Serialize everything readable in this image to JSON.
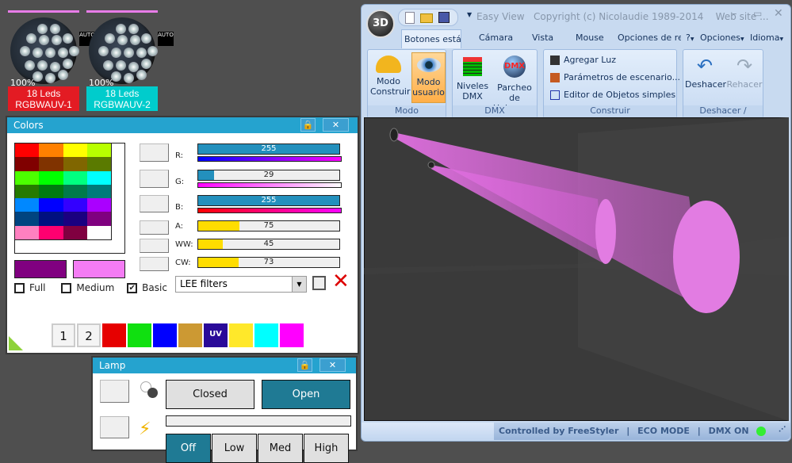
{
  "fixtures": [
    {
      "intensity": "100%",
      "name_line1": "18 Leds",
      "name_line2": "RGBWAUV-1",
      "auto_label": "AUTO",
      "color": "#e31b23"
    },
    {
      "intensity": "100%",
      "name_line1": "18 Leds",
      "name_line2": "RGBWAUV-2",
      "auto_label": "AUTO",
      "color": "#00cccc"
    }
  ],
  "colors_window": {
    "title": "Colors",
    "palette": [
      "#ff0000",
      "#ff8000",
      "#ffff00",
      "#b8ff00",
      "#800000",
      "#803300",
      "#806600",
      "#5a7a00",
      "#4cff00",
      "#00ff00",
      "#00ff80",
      "#00ffff",
      "#267a00",
      "#007a10",
      "#007a4a",
      "#007a7a",
      "#0088ff",
      "#0000ff",
      "#3300ff",
      "#aa00ff",
      "#004480",
      "#001080",
      "#1a0080",
      "#800080",
      "#ff80c0",
      "#ff0070",
      "#800040",
      "#ffffff"
    ],
    "selected_color_1": "#800080",
    "selected_color_2": "#f47cf4",
    "channels": [
      {
        "label": "R:",
        "value": 255,
        "max": 255,
        "fill": "#2390bd",
        "gradient": "linear-gradient(90deg,#0000ff,#ff00ff)"
      },
      {
        "label": "G:",
        "value": 29,
        "max": 255,
        "fill": "#2390bd",
        "gradient": "linear-gradient(90deg,#ff00ff,#fff)"
      },
      {
        "label": "B:",
        "value": 255,
        "max": 255,
        "fill": "#2390bd",
        "gradient": "linear-gradient(90deg,#ff0000,#ff00ff)"
      },
      {
        "label": "A:",
        "value": 75,
        "max": 255,
        "fill": "#ffdd00"
      },
      {
        "label": "WW:",
        "value": 45,
        "max": 255,
        "fill": "#ffdd00"
      },
      {
        "label": "CW:",
        "value": 73,
        "max": 255,
        "fill": "#ffdd00"
      }
    ],
    "filters": {
      "full": "Full",
      "medium": "Medium",
      "basic": "Basic",
      "full_checked": false,
      "medium_checked": false,
      "basic_checked": true
    },
    "filter_select": "LEE filters",
    "swatches": [
      {
        "label": "1",
        "color": "#f4f4f4"
      },
      {
        "label": "2",
        "color": "#f4f4f4"
      },
      {
        "label": "",
        "color": "#e60000"
      },
      {
        "label": "",
        "color": "#10e010"
      },
      {
        "label": "",
        "color": "#0000ff"
      },
      {
        "label": "",
        "color": "#cc9933"
      },
      {
        "label": "UV",
        "color": "#2a0a99"
      },
      {
        "label": "",
        "color": "#ffe82a"
      },
      {
        "label": "",
        "color": "#00ffff"
      },
      {
        "label": "",
        "color": "#ff00ff"
      }
    ]
  },
  "lamp_window": {
    "title": "Lamp",
    "closed": "Closed",
    "open": "Open",
    "modes": [
      "Off",
      "Low",
      "Med",
      "High"
    ]
  },
  "app": {
    "title": "Easy View   Copyright (c) Nicolaudie 1989-2014    Web site ...",
    "logo": "3D",
    "tabs": [
      "Botones estánd",
      "Cámara",
      "Vista",
      "Mouse",
      "Opciones de re"
    ],
    "right_menu": [
      "?",
      "Opciones",
      "Idioma"
    ],
    "groups": {
      "modo": {
        "label": "Modo",
        "buttons": [
          "Modo Construir",
          "Modo usuario"
        ]
      },
      "dmx": {
        "label": "DMX",
        "buttons": [
          "Niveles DMX",
          "Parcheo de Universos"
        ],
        "dmx_icon_text": "DMX"
      },
      "construir": {
        "label": "Construir",
        "items": [
          "Agregar Luz",
          "Parámetros de escenario...",
          "Editor de Objetos simples"
        ]
      },
      "undo": {
        "label": "Deshacer / Rehacer",
        "undo": "Deshacer",
        "redo": "Rehacer"
      }
    },
    "status": {
      "controlled": "Controlled by FreeStyler",
      "sep": "|",
      "eco": "ECO MODE",
      "dmx": "DMX ON",
      "dmx_led_color": "#33ee33"
    }
  }
}
